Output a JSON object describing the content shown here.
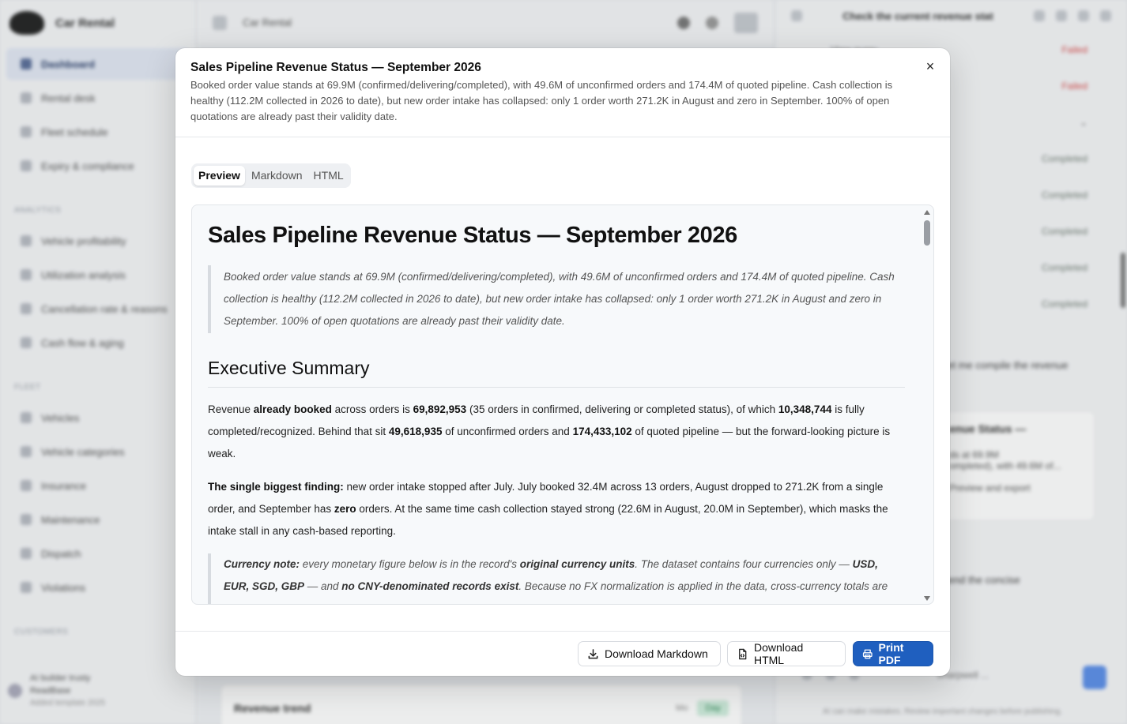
{
  "app": {
    "brand": "Car Rental",
    "topbar_title": "Car Rental",
    "nav": {
      "main": [
        "Dashboard",
        "Rental desk",
        "Fleet schedule",
        "Expiry & compliance"
      ],
      "analytics_title": "ANALYTICS",
      "analytics": [
        "Vehicle profitability",
        "Utilization analysis",
        "Cancellation rate & reasons",
        "Cash flow & aging"
      ],
      "fleet_title": "FLEET",
      "fleet": [
        "Vehicles",
        "Vehicle categories",
        "Insurance",
        "Maintenance",
        "Dispatch",
        "Violations"
      ],
      "customers_title": "CUSTOMERS"
    },
    "user": {
      "name": "AI builder trusty",
      "sub": "ReadBase",
      "meta": "Added template 2025"
    },
    "revenue_card": {
      "title": "Revenue trend",
      "chip": "Mo",
      "chip_green": "Day"
    },
    "assistant": {
      "title": "Check the current revenue stat",
      "rows": [
        {
          "label": "View query",
          "status": "Failed"
        },
        {
          "label": "",
          "status": "Failed"
        },
        {
          "label": "",
          "status": ""
        },
        {
          "label": "",
          "status": "Completed"
        },
        {
          "label": "",
          "status": "Completed"
        },
        {
          "label": "",
          "status": "Completed"
        },
        {
          "label": "",
          "status": "Completed"
        },
        {
          "label": "",
          "status": "Completed"
        }
      ],
      "message": "Let me compile the revenue",
      "card_title": "enue Status —",
      "card_line1": "ds at 69.9M",
      "card_line2": "ompleted), with 49.6M of...",
      "card_btn": "Preview and export",
      "message2": "Send the concise",
      "model": "Sharpwell ...",
      "footer": "AI can make mistakes. Review important changes before publishing."
    }
  },
  "modal": {
    "title": "Sales Pipeline Revenue Status — September 2026",
    "description": "Booked order value stands at 69.9M (confirmed/delivering/completed), with 49.6M of unconfirmed orders and 174.4M of quoted pipeline. Cash collection is healthy (112.2M collected in 2026 to date), but new order intake has collapsed: only 1 order worth 271.2K in August and zero in September. 100% of open quotations are already past their validity date.",
    "close_glyph": "×",
    "tabs": [
      "Preview",
      "Markdown",
      "HTML"
    ],
    "active_tab": "Preview",
    "doc": {
      "h1": "Sales Pipeline Revenue Status — September 2026",
      "quote": "Booked order value stands at 69.9M (confirmed/delivering/completed), with 49.6M of unconfirmed orders and 174.4M of quoted pipeline. Cash collection is healthy (112.2M collected in 2026 to date), but new order intake has collapsed: only 1 order worth 271.2K in August and zero in September. 100% of open quotations are already past their validity date.",
      "h2": "Executive Summary",
      "p1": {
        "a": "Revenue ",
        "b": "already booked",
        "c": " across orders is ",
        "d": "69,892,953",
        "e": " (35 orders in confirmed, delivering or completed status), of which ",
        "f": "10,348,744",
        "g": " is fully completed/recognized. Behind that sit ",
        "h": "49,618,935",
        "i": " of unconfirmed orders and ",
        "j": "174,433,102",
        "k": " of quoted pipeline — but the forward-looking picture is weak."
      },
      "p2": {
        "a": "The single biggest finding:",
        "b": " new order intake stopped after July. July booked 32.4M across 13 orders, August dropped to 271.2K from a single order, and September has ",
        "c": "zero",
        "d": " orders. At the same time cash collection stayed strong (22.6M in August, 20.0M in September), which masks the intake stall in any cash-based reporting."
      },
      "note": {
        "a": "Currency note:",
        "b": " every monetary figure below is in the record's ",
        "c": "original currency units",
        "d": ". The dataset contains four currencies only — ",
        "e": "USD, EUR, SGD, GBP",
        "f": " — and ",
        "g": "no CNY-denominated records exist",
        "h": ". Because no FX normalization is applied in the data, cross-currency totals are indicative only; per-currency splits are given where it matters."
      }
    },
    "buttons": {
      "download_md": "Download Markdown",
      "download_html": "Download HTML",
      "print_pdf": "Print PDF"
    },
    "colors": {
      "primary": "#1f5fbf",
      "preview_bg": "#f7f9fb"
    }
  }
}
